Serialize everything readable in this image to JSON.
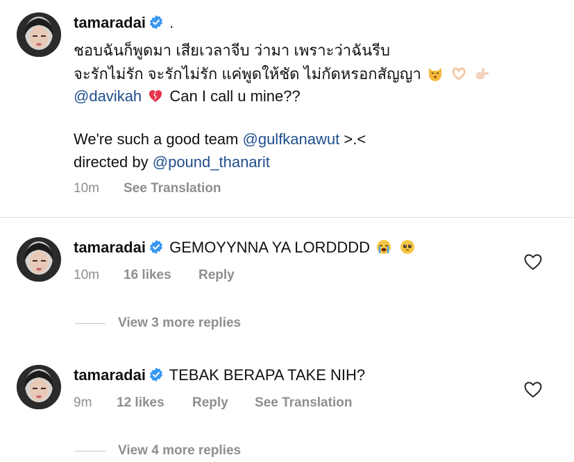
{
  "caption": {
    "username": "tamaradai",
    "dot": ".",
    "line1": "ชอบฉันก็พูดมา เสียเวลาจีบ ว่ามา เพราะว่าฉันรีบ",
    "line2": "จะรักไม่รัก จะรักไม่รัก แค่พูดให้ชัด ไม่กัดหรอกสัญญา",
    "mention_davikah": "@davikah",
    "call_text": "Can I call u mine??",
    "team_text": "We're such a good team",
    "mention_gulf": "@gulfkanawut",
    "team_tail": ">.<",
    "directed_text": "directed by",
    "mention_pound": "@pound_thanarit",
    "time": "10m",
    "see_translation": "See Translation"
  },
  "comments": [
    {
      "username": "tamaradai",
      "text": "GEMOYYNNA YA LORDDDD",
      "time": "10m",
      "likes": "16 likes",
      "reply": "Reply",
      "view_replies": "View 3 more replies"
    },
    {
      "username": "tamaradai",
      "text": "TEBAK BERAPA TAKE NIH?",
      "time": "9m",
      "likes": "12 likes",
      "reply": "Reply",
      "see_translation": "See Translation",
      "view_replies": "View 4 more replies"
    }
  ],
  "icons": {
    "verified": "verified-badge-icon",
    "heart": "heart-outline-icon",
    "emojis_caption": [
      "kissing-cat-emoji",
      "heart-hands-emoji",
      "pointing-hand-emoji"
    ],
    "emoji_mention": "mending-heart-emoji",
    "emojis_comment1": [
      "loudly-crying-emoji",
      "pleading-face-emoji"
    ]
  },
  "colors": {
    "mention": "#1f4e8c",
    "verified": "#3897f0",
    "secondary": "#8e8e8e"
  }
}
